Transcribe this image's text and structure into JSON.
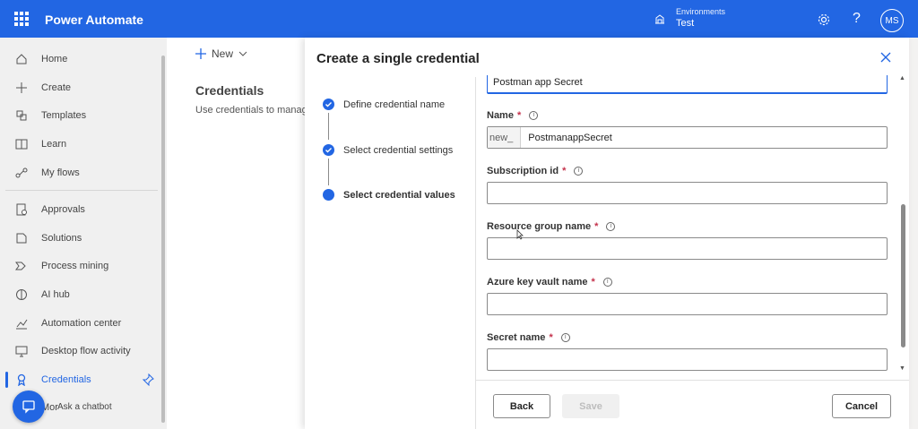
{
  "topbar": {
    "app_title": "Power Automate",
    "env_label": "Environments",
    "env_value": "Test",
    "avatar_initials": "MS",
    "help_glyph": "?"
  },
  "sidebar": {
    "items": [
      {
        "label": "Home",
        "icon": "home-icon"
      },
      {
        "label": "Create",
        "icon": "plus-icon"
      },
      {
        "label": "Templates",
        "icon": "templates-icon"
      },
      {
        "label": "Learn",
        "icon": "book-icon"
      },
      {
        "label": "My flows",
        "icon": "flow-icon"
      },
      {
        "label": "Approvals",
        "icon": "approvals-icon"
      },
      {
        "label": "Solutions",
        "icon": "solutions-icon"
      },
      {
        "label": "Process mining",
        "icon": "process-mining-icon"
      },
      {
        "label": "AI hub",
        "icon": "ai-hub-icon"
      },
      {
        "label": "Automation center",
        "icon": "chart-icon"
      },
      {
        "label": "Desktop flow activity",
        "icon": "desktop-icon"
      },
      {
        "label": "Credentials",
        "icon": "credentials-icon",
        "active": true
      }
    ],
    "more_label": "Mor",
    "chatbot_label": "Ask a chatbot"
  },
  "main": {
    "new_label": "New",
    "title": "Credentials",
    "description": "Use credentials to manag"
  },
  "panel": {
    "title": "Create a single credential",
    "steps": [
      {
        "label": "Define credential name",
        "state": "done"
      },
      {
        "label": "Select credential settings",
        "state": "done"
      },
      {
        "label": "Select credential values",
        "state": "current"
      }
    ],
    "top_field_value": "Postman app Secret",
    "fields": [
      {
        "label": "Name",
        "required": "*",
        "prefix": "new_",
        "value": "PostmanappSecret"
      },
      {
        "label": "Subscription id",
        "required": "*",
        "value": ""
      },
      {
        "label": "Resource group name",
        "required": "*",
        "value": ""
      },
      {
        "label": "Azure key vault name",
        "required": "*",
        "value": ""
      },
      {
        "label": "Secret name",
        "required": "*",
        "value": ""
      }
    ],
    "buttons": {
      "back": "Back",
      "save": "Save",
      "cancel": "Cancel"
    }
  },
  "colors": {
    "brand": "#2266e3",
    "required": "#c4314b"
  }
}
